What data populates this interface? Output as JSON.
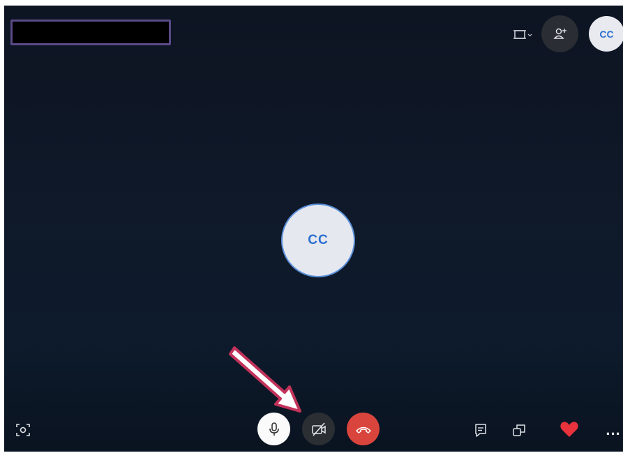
{
  "caller": {
    "name_redacted": "",
    "avatar_initials": "CC"
  },
  "top_bar": {
    "layout_icon": "layout-icon",
    "add_person_icon": "add-person-icon",
    "self_avatar_initials": "CC"
  },
  "controls": {
    "screenshot_icon": "camera-snapshot-icon",
    "mic_icon": "microphone-icon",
    "video_icon": "video-off-icon",
    "hangup_icon": "phone-hangup-icon",
    "chat_icon": "chat-icon",
    "switch_icon": "switch-window-icon",
    "reaction_icon": "heart-icon",
    "more_label": "..."
  },
  "colors": {
    "hangup": "#d9453c",
    "heart": "#e8323c",
    "avatar_text": "#2b6fd0",
    "annotation_arrow": "#c2325a"
  }
}
